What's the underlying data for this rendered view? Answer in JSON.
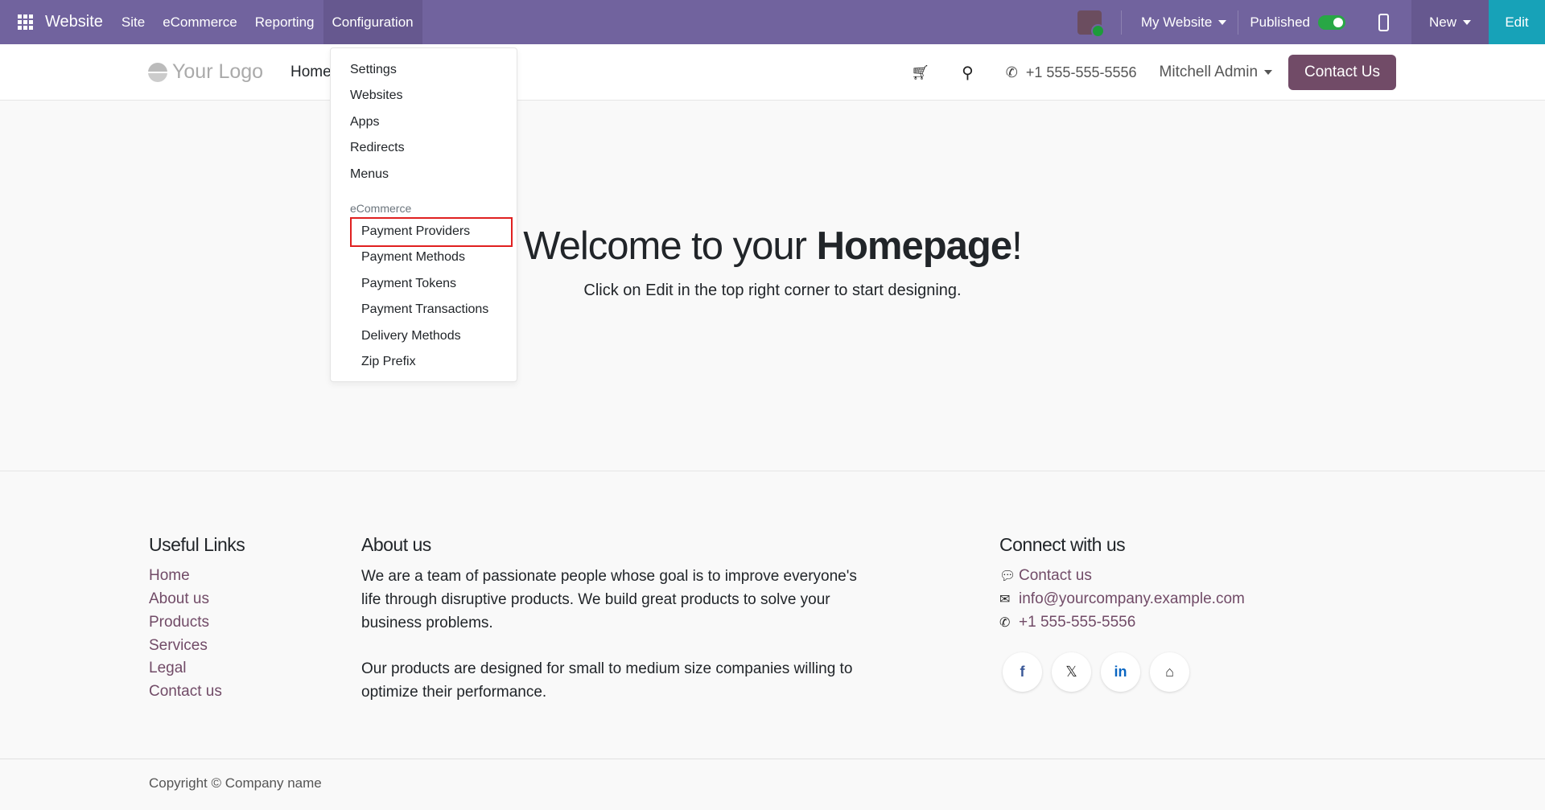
{
  "topbar": {
    "app": "Website",
    "menus": [
      "Site",
      "eCommerce",
      "Reporting",
      "Configuration"
    ],
    "active_menu": "Configuration",
    "website_selector": "My Website",
    "published_label": "Published",
    "published": true,
    "new_label": "New",
    "edit_label": "Edit"
  },
  "header": {
    "logo": "Your Logo",
    "nav_home": "Home",
    "phone": "+1 555-555-5556",
    "user": "Mitchell Admin",
    "contact_button": "Contact Us"
  },
  "dropdown": {
    "items": [
      "Settings",
      "Websites",
      "Apps",
      "Redirects",
      "Menus"
    ],
    "section": "eCommerce",
    "ecommerce_items": [
      "Payment Providers",
      "Payment Methods",
      "Payment Tokens",
      "Payment Transactions",
      "Delivery Methods",
      "Zip Prefix"
    ],
    "highlighted": "Payment Providers"
  },
  "main": {
    "title_pre": "Welcome to your ",
    "title_bold": "Homepage",
    "title_post": "!",
    "sub_pre": "Click on ",
    "sub_bold": "Edit",
    "sub_post": " in the top right corner to start designing."
  },
  "footer": {
    "links_title": "Useful Links",
    "links": [
      "Home",
      "About us",
      "Products",
      "Services",
      "Legal",
      "Contact us"
    ],
    "about_title": "About us",
    "about_p1": "We are a team of passionate people whose goal is to improve everyone's life through disruptive products. We build great products to solve your business problems.",
    "about_p2": "Our products are designed for small to medium size companies willing to optimize their performance.",
    "connect_title": "Connect with us",
    "contact": "Contact us",
    "email": "info@yourcompany.example.com",
    "phone": "+1 555-555-5556",
    "social": [
      "facebook-icon",
      "x-icon",
      "linkedin-icon",
      "home-icon"
    ],
    "copyright": "Copyright © Company name"
  },
  "colors": {
    "navbar": "#71639e",
    "edit": "#17a2b8",
    "brand": "#714b67",
    "highlight": "#e02020"
  }
}
